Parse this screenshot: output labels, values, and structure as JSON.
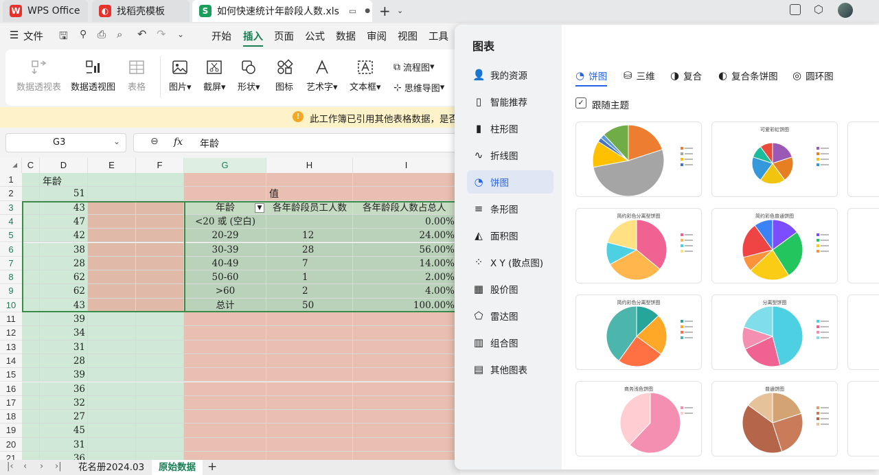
{
  "tabs": {
    "wps": "WPS Office",
    "daoke": "找稻壳模板",
    "doc": "如何快速统计年龄段人数.xls"
  },
  "menu": {
    "file": "文件",
    "items": [
      "开始",
      "插入",
      "页面",
      "公式",
      "数据",
      "审阅",
      "视图",
      "工具"
    ],
    "active": "插入"
  },
  "ribbon": {
    "pivot_table": "数据透视表",
    "pivot_chart": "数据透视图",
    "table": "表格",
    "picture": "图片",
    "screenshot": "截屏",
    "shape": "形状",
    "icon": "图标",
    "wordart": "艺术字",
    "textbox": "文本框",
    "flowchart": "流程图",
    "mindmap": "思维导图"
  },
  "notice": "此工作簿已引用其他表格数据，是否...",
  "formula_bar": {
    "name_box": "G3",
    "fx": "fx",
    "content": "年龄"
  },
  "grid": {
    "col_headers": [
      "C",
      "D",
      "E",
      "F",
      "G",
      "H",
      "I"
    ],
    "row_numbers": [
      "1",
      "2",
      "3",
      "4",
      "5",
      "6",
      "7",
      "8",
      "9",
      "10",
      "11",
      "12",
      "13",
      "14",
      "15",
      "16",
      "17",
      "18",
      "19",
      "20",
      "21"
    ],
    "d_header": "年龄",
    "d_values": [
      "51",
      "43",
      "47",
      "42",
      "38",
      "28",
      "62",
      "62",
      "43",
      "39",
      "34",
      "31",
      "28",
      "39",
      "36",
      "32",
      "27",
      "45",
      "31",
      "36"
    ],
    "pivot": {
      "value_label": "值",
      "headers": [
        "年龄",
        "各年龄段员工人数",
        "各年龄段人数占总人"
      ],
      "rows": [
        [
          "<20 或 (空白)",
          "",
          "0.00%"
        ],
        [
          "20-29",
          "12",
          "24.00%"
        ],
        [
          "30-39",
          "28",
          "56.00%"
        ],
        [
          "40-49",
          "7",
          "14.00%"
        ],
        [
          "50-60",
          "1",
          "2.00%"
        ],
        [
          ">60",
          "2",
          "4.00%"
        ],
        [
          "总计",
          "50",
          "100.00%"
        ]
      ]
    }
  },
  "sheets": {
    "tabs": [
      "花名册2024.03",
      "原始数据"
    ],
    "active": "原始数据"
  },
  "chart_panel": {
    "title": "图表",
    "categories": [
      "我的资源",
      "智能推荐",
      "柱形图",
      "折线图",
      "饼图",
      "条形图",
      "面积图",
      "X Y (散点图)",
      "股价图",
      "雷达图",
      "组合图",
      "其他图表"
    ],
    "selected": "饼图",
    "subtabs": [
      "饼图",
      "三维",
      "复合",
      "复合条饼图",
      "圆环图"
    ],
    "follow_theme": "跟随主题",
    "template_titles": [
      "",
      "可爱彩虹饼图",
      "简约彩色分离型饼图",
      "简约彩色普通饼图",
      "简约彩色分离型饼图",
      "分离型饼图",
      "商务浅色饼图",
      "普通饼图"
    ]
  }
}
